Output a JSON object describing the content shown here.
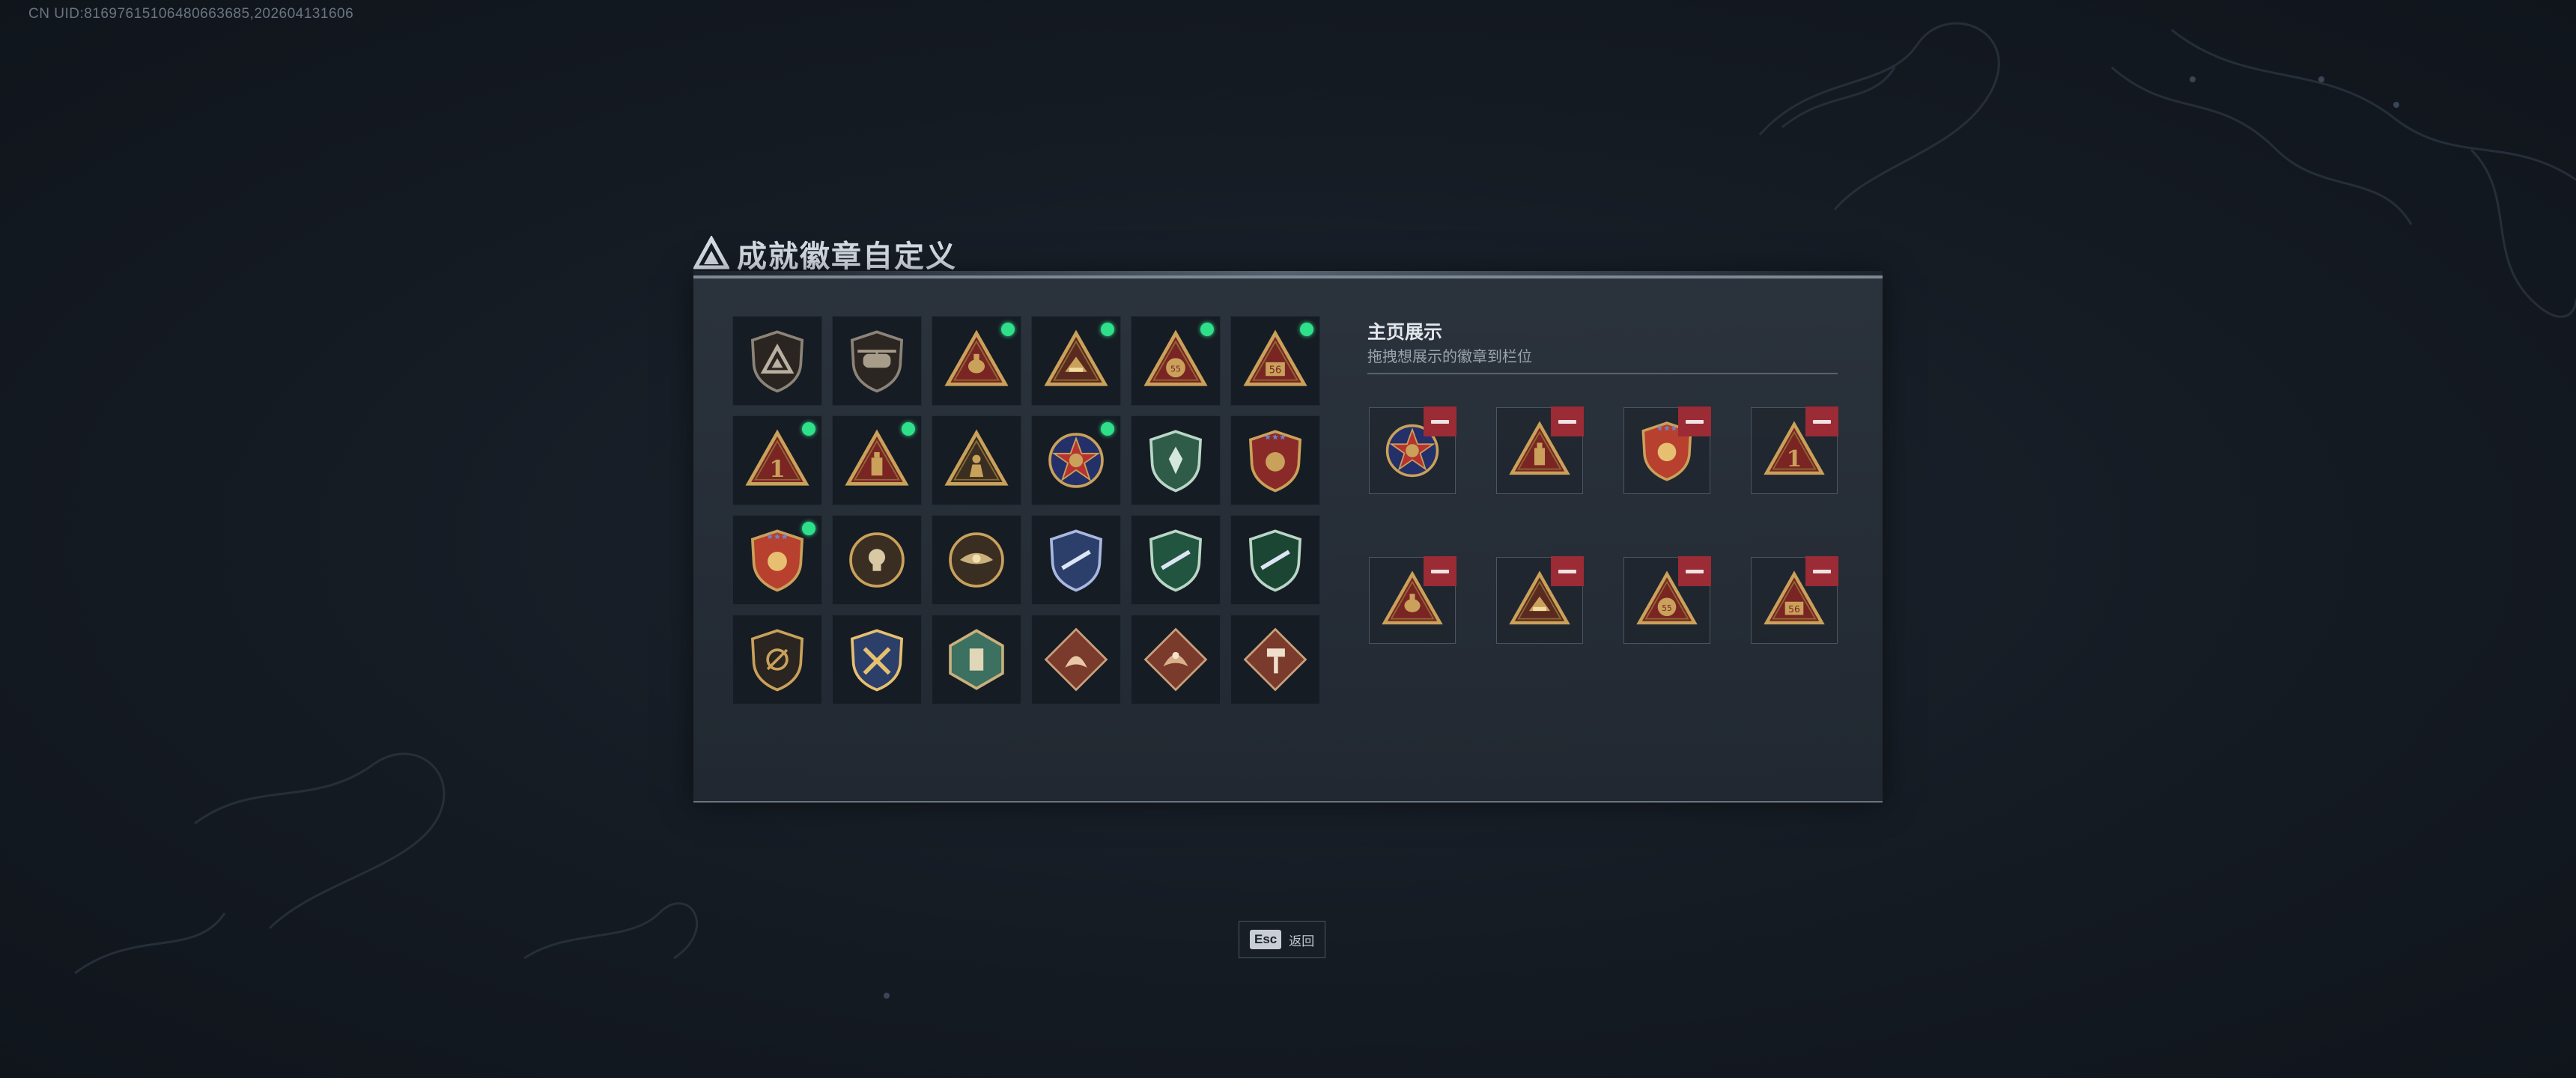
{
  "uid_text": "CN UID:8169761510648066368​5,202604131606",
  "window": {
    "title": "成就徽章自定义",
    "title_icon": "triangle-logo-icon"
  },
  "colors": {
    "accent_green": "#2fe08a",
    "remove_red": "#9b2b35",
    "gold": "#c9a15a"
  },
  "badges": [
    {
      "icon": "shield-triangle-badge-icon",
      "new": false
    },
    {
      "icon": "helicopter-shield-badge-icon",
      "new": false
    },
    {
      "icon": "triangle-hand-badge-icon",
      "new": true
    },
    {
      "icon": "triangle-hat-badge-icon",
      "new": true
    },
    {
      "icon": "triangle-55-sack-badge-icon",
      "new": true
    },
    {
      "icon": "triangle-56-badge-icon",
      "new": true
    },
    {
      "icon": "triangle-number-1-badge-icon",
      "new": true
    },
    {
      "icon": "triangle-tower-badge-icon",
      "new": true
    },
    {
      "icon": "triangle-soldier-badge-icon",
      "new": false
    },
    {
      "icon": "star-medal-badge-icon",
      "new": true
    },
    {
      "icon": "green-shield-badge-icon",
      "new": false
    },
    {
      "icon": "red-shield-stars-badge-icon",
      "new": false
    },
    {
      "icon": "gold-shield-stars-badge-icon",
      "new": true
    },
    {
      "icon": "skull-circle-badge-icon",
      "new": false
    },
    {
      "icon": "eagle-circle-badge-icon",
      "new": false
    },
    {
      "icon": "blue-rifle-shield-badge-icon",
      "new": false
    },
    {
      "icon": "green-rifle-shield-badge-icon",
      "new": false
    },
    {
      "icon": "dark-green-rifle-shield-badge-icon",
      "new": false
    },
    {
      "icon": "crosshair-shield-badge-icon",
      "new": false
    },
    {
      "icon": "crossed-axes-shield-badge-icon",
      "new": false
    },
    {
      "icon": "teal-hexagon-badge-icon",
      "new": false
    },
    {
      "icon": "dragon-diamond-badge-icon",
      "new": false
    },
    {
      "icon": "dragon-diamond-2-badge-icon",
      "new": false
    },
    {
      "icon": "hammer-diamond-badge-icon",
      "new": false
    }
  ],
  "showcase": {
    "title": "主页展示",
    "subtitle": "拖拽想展示的徽章到栏位",
    "slots": [
      {
        "icon": "star-medal-badge-icon"
      },
      {
        "icon": "triangle-tower-badge-icon"
      },
      {
        "icon": "gold-shield-stars-badge-icon"
      },
      {
        "icon": "triangle-number-1-badge-icon"
      },
      {
        "icon": "triangle-hand-badge-icon"
      },
      {
        "icon": "triangle-hat-badge-icon"
      },
      {
        "icon": "triangle-55-sack-badge-icon"
      },
      {
        "icon": "triangle-56-badge-icon"
      }
    ]
  },
  "footer": {
    "esc_key": "Esc",
    "esc_label": "返回"
  }
}
